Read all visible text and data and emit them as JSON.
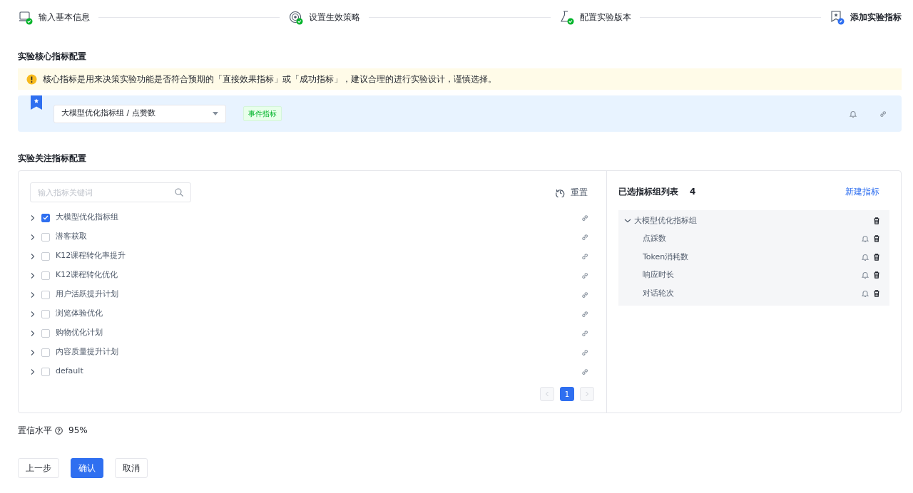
{
  "steps": [
    {
      "label": "输入基本信息",
      "completed": true
    },
    {
      "label": "设置生效策略",
      "completed": true
    },
    {
      "label": "配置实验版本",
      "completed": true
    },
    {
      "label": "添加实验指标",
      "completed": false
    }
  ],
  "core_section": {
    "title": "实验核心指标配置",
    "alert": "核心指标是用来决策实验功能是否符合预期的「直接效果指标」或「成功指标」，建议合理的进行实验设计，谨慎选择。",
    "metric_select": "大模型优化指标组 / 点赞数",
    "tag": "事件指标"
  },
  "focus_section": {
    "title": "实验关注指标配置",
    "search": {
      "placeholder": "输入指标关键词"
    },
    "reset_button": "重置",
    "groups": [
      {
        "label": "大模型优化指标组",
        "checked": true
      },
      {
        "label": "潜客获取",
        "checked": false
      },
      {
        "label": "K12课程转化率提升",
        "checked": false
      },
      {
        "label": "K12课程转化优化",
        "checked": false
      },
      {
        "label": "用户活跃提升计划",
        "checked": false
      },
      {
        "label": "浏览体验优化",
        "checked": false
      },
      {
        "label": "购物优化计划",
        "checked": false
      },
      {
        "label": "内容质量提升计划",
        "checked": false
      },
      {
        "label": "default",
        "checked": false
      }
    ],
    "pagination": {
      "pages": [
        {
          "label": "1",
          "selected": true
        }
      ]
    },
    "selected_panel": {
      "title": "已选指标组列表",
      "count": "4",
      "new_button": "新建指标",
      "groups": [
        {
          "label": "大模型优化指标组",
          "expanded": true,
          "children": [
            {
              "label": "点踩数"
            },
            {
              "label": "Token消耗数"
            },
            {
              "label": "响应时长"
            },
            {
              "label": "对话轮次"
            }
          ]
        }
      ]
    }
  },
  "confidence": {
    "label": "置信水平",
    "value": "95%"
  },
  "buttons": [
    {
      "label": "上一步",
      "kind": "default"
    },
    {
      "label": "确认",
      "kind": "primary"
    },
    {
      "label": "取消",
      "kind": "default"
    }
  ]
}
